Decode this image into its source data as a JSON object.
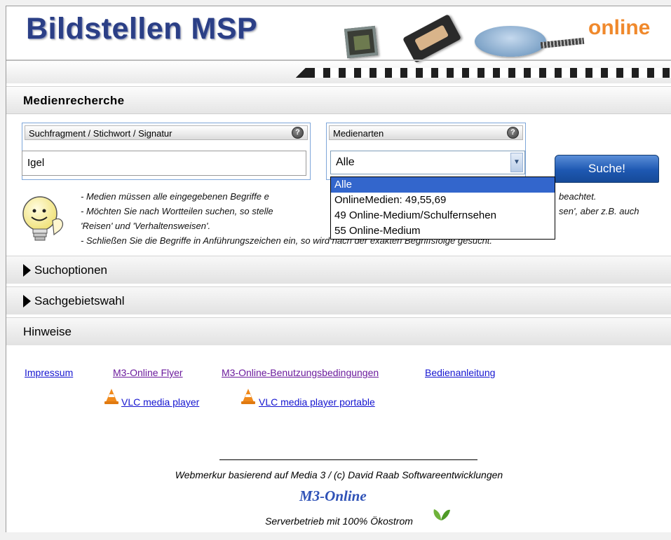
{
  "banner": {
    "title": "Bildstellen MSP",
    "suffix": "online"
  },
  "section": {
    "title": "Medienrecherche"
  },
  "search": {
    "label": "Suchfragment / Stichwort / Signatur",
    "help": "?",
    "value": "Igel"
  },
  "media_types": {
    "label": "Medienarten",
    "help": "?",
    "selected": "Alle",
    "options": [
      "Alle",
      "OnlineMedien: 49,55,69",
      "49 Online-Medium/Schulfernsehen",
      "55 Online-Medium"
    ]
  },
  "search_button": "Suche!",
  "tips": {
    "l1a": "- Medien müssen alle eingegebenen Begriffe e",
    "l1b": "beachtet.",
    "l2a": "- Möchten Sie nach Wortteilen suchen, so stelle",
    "l2b": "sen', aber z.B. auch",
    "l3": "'Reisen' und 'Verhaltensweisen'.",
    "l4": "- Schließen Sie die Begriffe in Anführungszeichen ein, so wird nach der exakten Begriffsfolge gesucht."
  },
  "accordion": {
    "options": "Suchoptionen",
    "subjects": "Sachgebietswahl",
    "notes": "Hinweise"
  },
  "links": {
    "impressum": "Impressum",
    "flyer": "M3-Online Flyer",
    "terms": "M3-Online-Benutzungsbedingungen",
    "manual": "Bedienanleitung",
    "vlc": "VLC media player",
    "vlc_portable": "VLC media player portable"
  },
  "footer": {
    "credit": "Webmerkur basierend auf Media 3 / (c) David Raab Softwareentwicklungen",
    "logo": "M3-Online",
    "eco": "Serverbetrieb mit 100% Ökostrom"
  },
  "colors": {
    "banner_title": "#2b3f86",
    "banner_online": "#f0892c",
    "accent_blue": "#3366cc",
    "link_blue": "#1515d0",
    "link_purple": "#6b1a9c"
  },
  "icons": [
    "help-icon",
    "dropdown-arrow-icon",
    "lightbulb-icon",
    "triangle-right-icon",
    "vlc-cone-icon",
    "leaf-icon"
  ]
}
